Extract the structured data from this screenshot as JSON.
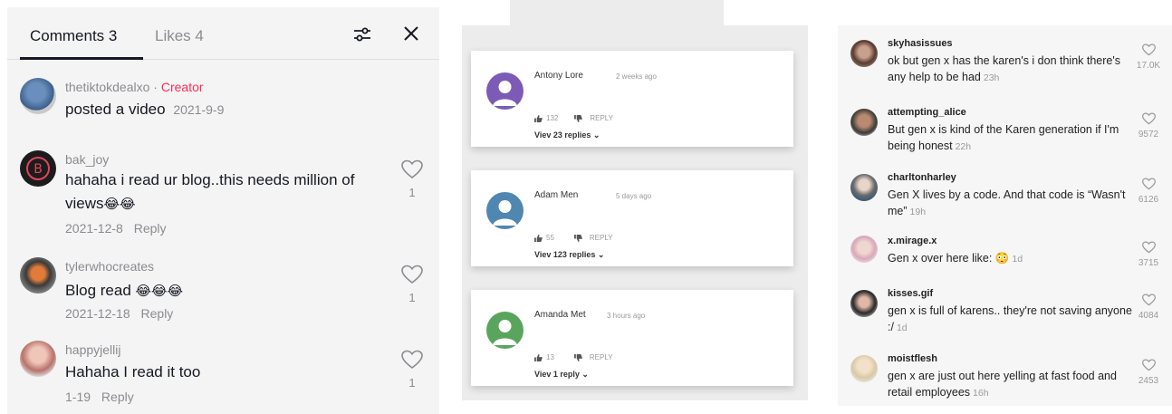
{
  "panel_a": {
    "tabs": {
      "comments": "Comments 3",
      "likes": "Likes 4"
    },
    "icons": {
      "filter": "filter-sliders-icon",
      "close": "close-icon"
    },
    "creator_post": {
      "user": "thetiktokdealxo",
      "separator": " · ",
      "badge": "Creator",
      "text": "posted a video",
      "date": "2021-9-9"
    },
    "comments": [
      {
        "user": "bak_joy",
        "text": "hahaha i read ur blog..this needs million of views",
        "emoji": "😂😂",
        "date": "2021-12-8",
        "reply": "Reply",
        "likes": "1"
      },
      {
        "user": "tylerwhocreates",
        "text": "Blog read ",
        "emoji": "😂😂😂",
        "date": "2021-12-18",
        "reply": "Reply",
        "likes": "1"
      },
      {
        "user": "happyjellij",
        "text": "Hahaha I read it too",
        "emoji": "",
        "date": "1-19",
        "reply": "Reply",
        "likes": "1"
      }
    ]
  },
  "panel_b": {
    "cards": [
      {
        "name": "Antony Lore",
        "time": "2 weeks ago",
        "likes": "132",
        "reply": "REPLY",
        "views": "Viev 23 replies ⌄",
        "avatar_color": "#7b5bb6"
      },
      {
        "name": "Adam Men",
        "time": "5 days ago",
        "likes": "55",
        "reply": "REPLY",
        "views": "Viev 123 replies ⌄",
        "avatar_color": "#4f87b0"
      },
      {
        "name": "Amanda Met",
        "time": "3 hours ago",
        "likes": "13",
        "reply": "REPLY",
        "views": "Viev 1 reply  ⌄",
        "avatar_color": "#5aa55d"
      }
    ]
  },
  "panel_c": {
    "comments": [
      {
        "user": "skyhasissues",
        "text": "ok but gen x has the karen's i don think there's any help to be had",
        "time": "23h",
        "likes": "17.0K"
      },
      {
        "user": "attempting_alice",
        "text": "But gen x is kind of the Karen generation if I'm being honest",
        "time": "22h",
        "likes": "9572"
      },
      {
        "user": "charltonharley",
        "text": "Gen X lives by a code. And that code is “Wasn't me”",
        "time": "19h",
        "likes": "6126"
      },
      {
        "user": "x.mirage.x",
        "text": "Gen x over here like: 😳",
        "time": "1d",
        "likes": "3715"
      },
      {
        "user": "kisses.gif",
        "text": "gen x is full of karens.. they're not saving anyone :/",
        "time": "1d",
        "likes": "4084"
      },
      {
        "user": "moistflesh",
        "text": "gen x are just out here yelling at fast food and retail employees",
        "time": "16h",
        "likes": "2453"
      }
    ]
  }
}
